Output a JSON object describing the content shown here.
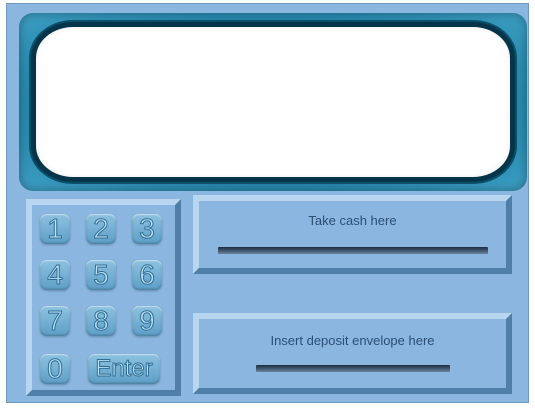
{
  "keypad": {
    "keys": [
      "1",
      "2",
      "3",
      "4",
      "5",
      "6",
      "7",
      "8",
      "9",
      "0"
    ],
    "enter_label": "Enter"
  },
  "cash_dispenser": {
    "label": "Take cash here"
  },
  "deposit_slot": {
    "label": "Insert deposit envelope here"
  },
  "colors": {
    "body": "#8ab6e0",
    "screen": "#ffffff",
    "screen_border": "#06354a",
    "key": "#6aa9cf",
    "slot_opening": "#2a3c52"
  }
}
